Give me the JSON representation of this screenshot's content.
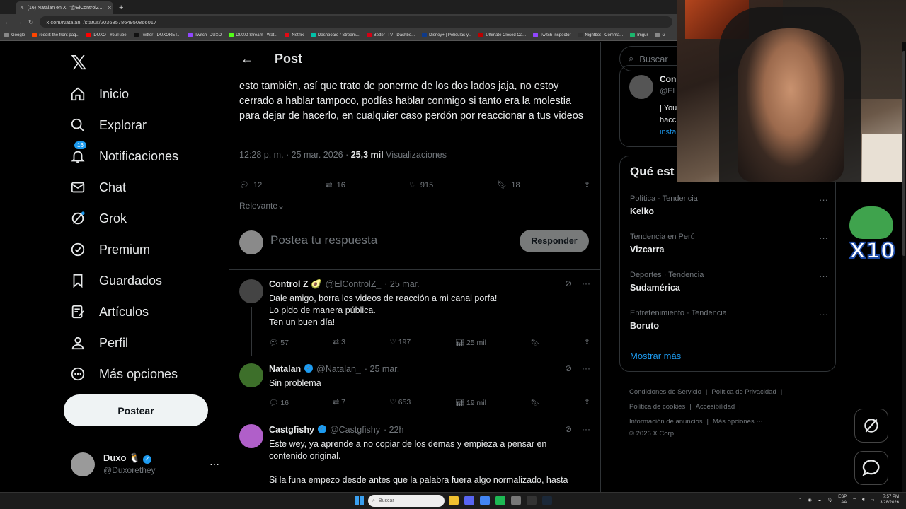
{
  "browser": {
    "tab_title": "(16) Natalan en X: \"@ElControlZ…",
    "url": "x.com/Natalan_/status/2036857864950866017",
    "bookmarks": [
      "Google",
      "reddit: the front pag...",
      "DUXO - YouTube",
      "Twitter - DUXORET...",
      "Twitch- DUXO",
      "DUXO Stream - Wat...",
      "Netflix",
      "Dashboard / Stream...",
      "BetterTTV - Dashbo...",
      "Disney+ | Películas y...",
      "Ultimate Closed Ca...",
      "Twitch Inspector",
      "Nightbot - Comma...",
      "Imgur",
      "G"
    ]
  },
  "nav": {
    "items": [
      {
        "label": "Inicio",
        "icon": "home-icon"
      },
      {
        "label": "Explorar",
        "icon": "search-icon"
      },
      {
        "label": "Notificaciones",
        "icon": "bell-icon",
        "badge": "16"
      },
      {
        "label": "Chat",
        "icon": "mail-icon"
      },
      {
        "label": "Grok",
        "icon": "grok-icon"
      },
      {
        "label": "Premium",
        "icon": "premium-icon"
      },
      {
        "label": "Guardados",
        "icon": "bookmark-icon"
      },
      {
        "label": "Artículos",
        "icon": "article-icon"
      },
      {
        "label": "Perfil",
        "icon": "person-icon"
      },
      {
        "label": "Más opciones",
        "icon": "more-circle-icon"
      }
    ],
    "post_button": "Postear",
    "account": {
      "name": "Duxo",
      "emoji": "🐧",
      "handle": "@Duxorethey",
      "more": "···"
    }
  },
  "main": {
    "header_title": "Post",
    "tweet_text": "esto también, así que trato de ponerme de los dos lados jaja, no estoy cerrado a hablar tampoco, podías hablar conmigo si tanto era la molestia para dejar de hacerlo, en cualquier caso perdón por reaccionar a tus videos",
    "meta": {
      "time": "12:28 p. m. · 25 mar. 2026 · ",
      "views": "25,3 mil",
      "views_label": " Visualizaciones"
    },
    "actions": {
      "replies": "12",
      "reposts": "16",
      "likes": "915",
      "bookmarks": "18"
    },
    "sort": "Relevante",
    "reply_placeholder": "Postea tu respuesta",
    "reply_button": "Responder",
    "replies": [
      {
        "name": "Control Z 🥑",
        "handle": "@ElControlZ_",
        "date": "· 25 mar.",
        "verified": false,
        "lines": [
          "Dale amigo, borra los videos de reacción a mi canal porfa!",
          "Lo pido de manera pública.",
          "Ten un buen día!"
        ],
        "replies": "57",
        "reposts": "3",
        "likes": "197",
        "views": "25 mil"
      },
      {
        "name": "Natalan",
        "handle": "@Natalan_",
        "date": "· 25 mar.",
        "verified": true,
        "lines": [
          "Sin problema"
        ],
        "replies": "16",
        "reposts": "7",
        "likes": "653",
        "views": "19 mil"
      },
      {
        "name": "Castgfishy",
        "handle": "@Castgfishy",
        "date": "· 22h",
        "verified": true,
        "lines": [
          "Este wey, ya aprende a no copiar de los demas y empieza a pensar en",
          "contenido original.",
          "",
          "Si la funa empezo desde antes que la palabra fuera algo normalizado, hasta"
        ]
      }
    ]
  },
  "right": {
    "search_placeholder": "Buscar",
    "card": {
      "name": "Con",
      "handle": "@El",
      "text1": "| You",
      "text2": "hacc",
      "link": "insta"
    },
    "trends_title": "Qué est",
    "trends": [
      {
        "context": "Política · Tendencia",
        "name": "Keiko"
      },
      {
        "context": "Tendencia en Perú",
        "name": "Vizcarra"
      },
      {
        "context": "Deportes · Tendencia",
        "name": "Sudamérica"
      },
      {
        "context": "Entretenimiento · Tendencia",
        "name": "Boruto"
      }
    ],
    "show_more": "Mostrar más",
    "footer": [
      "Condiciones de Servicio",
      "|",
      "Política de Privacidad",
      "|",
      "Política de cookies",
      "|",
      "Accesibilidad",
      "|",
      "Información de anuncios",
      "|",
      "Más opciones ···",
      "© 2026 X Corp."
    ]
  },
  "overlay": {
    "emote_text": "X10"
  },
  "taskbar": {
    "search": "Buscar",
    "lang": "ESP",
    "lang2": "LAA",
    "time": "7:57 PM",
    "date": "3/28/2026"
  },
  "colors": {
    "accent": "#1d9bf0",
    "bg": "#000000",
    "muted": "#71767b",
    "border": "#2f3336"
  }
}
